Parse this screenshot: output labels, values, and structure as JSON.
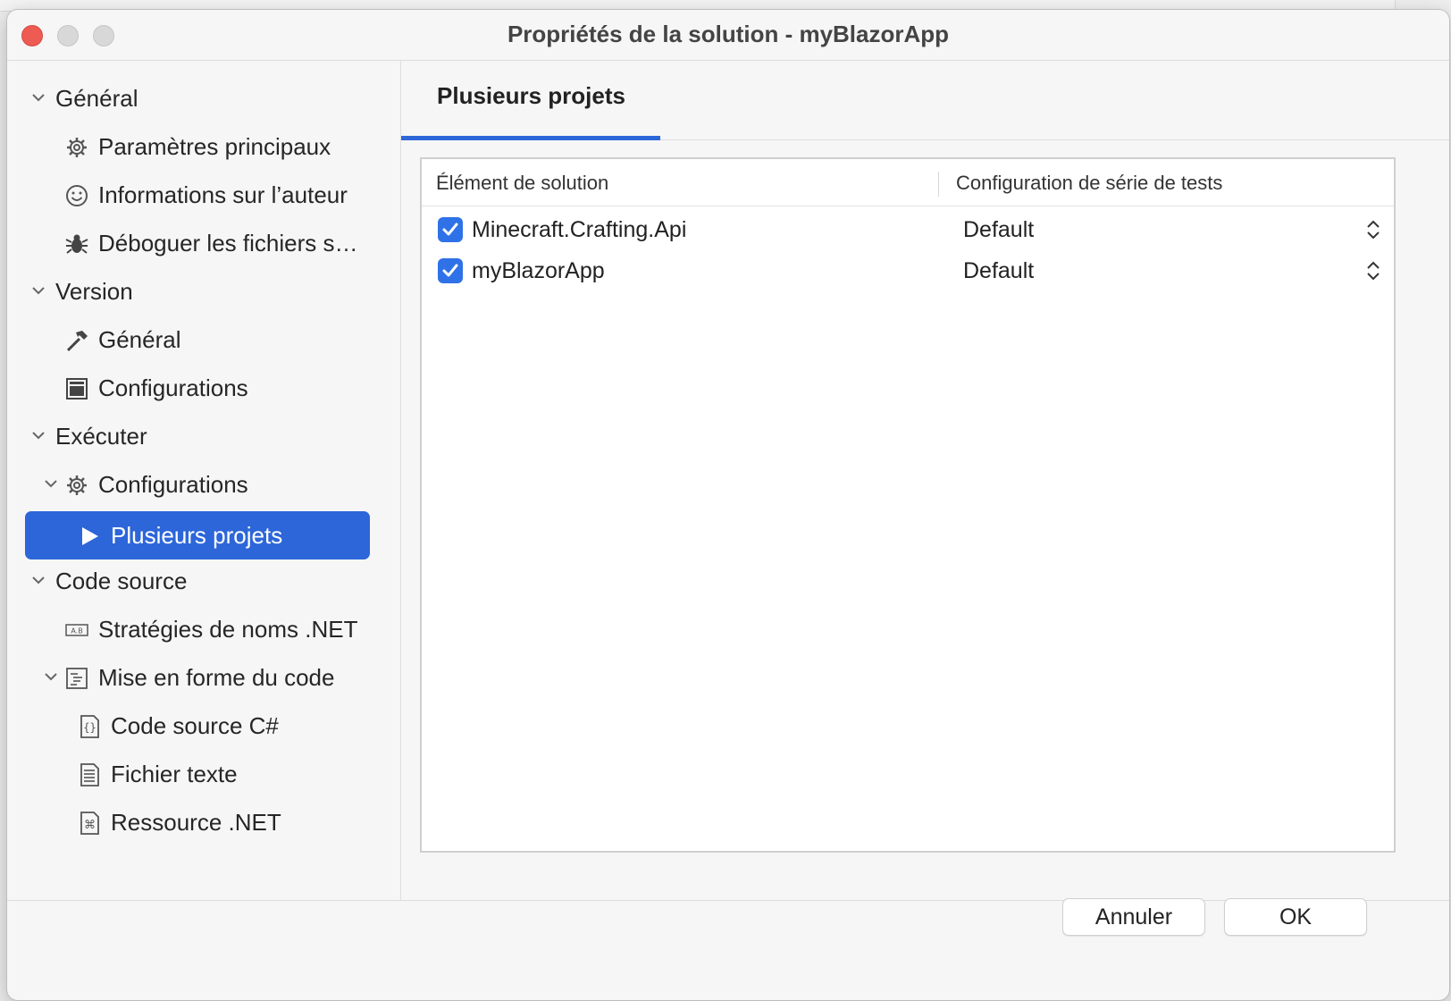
{
  "window": {
    "title": "Propriétés de la solution - myBlazorApp"
  },
  "sidebar": {
    "items": [
      {
        "label": "Général",
        "level": 0,
        "expanded": true,
        "icon": "chevron-down-icon"
      },
      {
        "label": "Paramètres principaux",
        "level": 1,
        "icon": "gear-icon"
      },
      {
        "label": "Informations sur l’auteur",
        "level": 1,
        "icon": "smiley-icon"
      },
      {
        "label": "Déboguer les fichiers s…",
        "level": 1,
        "icon": "bug-icon"
      },
      {
        "label": "Version",
        "level": 0,
        "expanded": true,
        "icon": "chevron-down-icon"
      },
      {
        "label": "Général",
        "level": 1,
        "icon": "hammer-icon"
      },
      {
        "label": "Configurations",
        "level": 1,
        "icon": "window-icon"
      },
      {
        "label": "Exécuter",
        "level": 0,
        "expanded": true,
        "icon": "chevron-down-icon"
      },
      {
        "label": "Configurations",
        "level": 1,
        "expanded": true,
        "icon": "gear-icon"
      },
      {
        "label": "Plusieurs projets",
        "level": 2,
        "selected": true,
        "icon": "play-icon"
      },
      {
        "label": "Code source",
        "level": 0,
        "expanded": true,
        "icon": "chevron-down-icon"
      },
      {
        "label": "Stratégies de noms .NET",
        "level": 1,
        "icon": "naming-icon"
      },
      {
        "label": "Mise en forme du code",
        "level": 1,
        "expanded": true,
        "icon": "code-format-icon"
      },
      {
        "label": "Code source C#",
        "level": 2,
        "icon": "braces-file-icon"
      },
      {
        "label": "Fichier texte",
        "level": 2,
        "icon": "text-file-icon"
      },
      {
        "label": "Ressource .NET",
        "level": 2,
        "icon": "command-file-icon"
      }
    ]
  },
  "main": {
    "tab": {
      "label": "Plusieurs projets"
    },
    "table": {
      "columns": [
        "Élément de solution",
        "Configuration de série de tests"
      ],
      "rows": [
        {
          "checked": true,
          "name": "Minecraft.Crafting.Api",
          "config": "Default"
        },
        {
          "checked": true,
          "name": "myBlazorApp",
          "config": "Default"
        }
      ]
    }
  },
  "footer": {
    "cancel_label": "Annuler",
    "ok_label": "OK"
  },
  "colors": {
    "accent": "#2d66d9",
    "checkbox": "#2f72e8",
    "close": "#ee5b52"
  }
}
